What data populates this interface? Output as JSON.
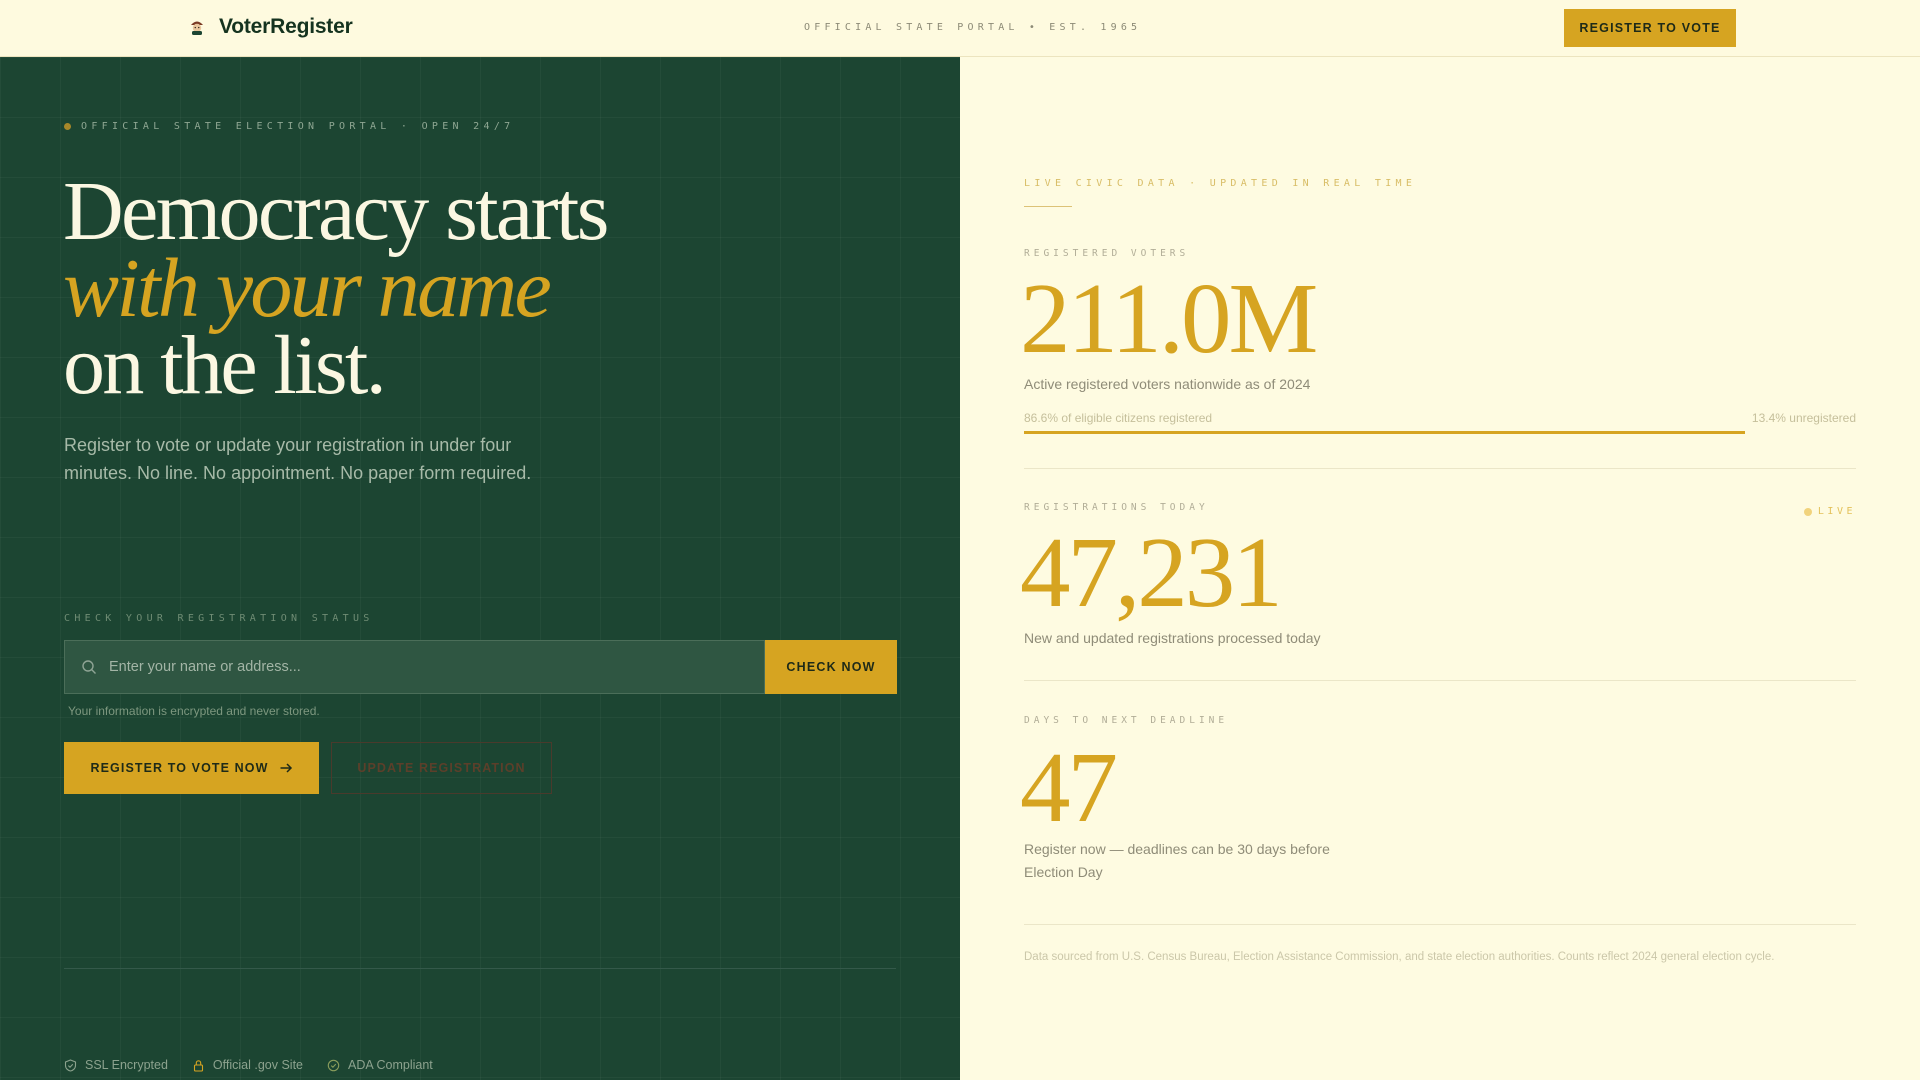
{
  "nav": {
    "brand": "VoterRegister",
    "tagline": "OFFICIAL STATE PORTAL • EST. 1965",
    "cta": "REGISTER TO VOTE"
  },
  "hero": {
    "eyebrow": "OFFICIAL STATE ELECTION PORTAL · OPEN 24/7",
    "headline_line1": "Democracy starts",
    "headline_line2": "with your name",
    "headline_line3": "on the list.",
    "subcopy": "Register to vote or update your registration in under four minutes. No line. No appointment. No paper form required.",
    "status_label": "CHECK YOUR REGISTRATION STATUS",
    "search_placeholder": "Enter your name or address...",
    "search_value": "",
    "check_button": "CHECK NOW",
    "privacy_note": "Your information is encrypted and never stored.",
    "primary_button": "REGISTER TO VOTE NOW",
    "secondary_button": "UPDATE REGISTRATION",
    "trust": [
      {
        "icon": "shield-icon",
        "label": "SSL Encrypted"
      },
      {
        "icon": "lock-icon",
        "label": "Official .gov Site"
      },
      {
        "icon": "check-circle-icon",
        "label": "ADA Compliant"
      }
    ]
  },
  "stats": {
    "eyebrow": "LIVE CIVIC DATA · UPDATED IN REAL TIME",
    "registered": {
      "label": "REGISTERED VOTERS",
      "value": "211.0M",
      "desc": "Active registered voters nationwide as of 2024",
      "bar_left": "86.6% of eligible citizens registered",
      "bar_right": "13.4% unregistered",
      "percent_registered": 86.6
    },
    "today": {
      "label": "REGISTRATIONS TODAY",
      "value": "47,231",
      "desc": "New and updated registrations processed today",
      "live": "LIVE"
    },
    "deadline": {
      "label": "DAYS TO NEXT DEADLINE",
      "value": "47",
      "desc": "Register now — deadlines can be 30 days before Election Day"
    },
    "source": "Data sourced from U.S. Census Bureau, Election Assistance Commission, and state election authorities. Counts reflect 2024 general election cycle."
  },
  "colors": {
    "hero_bg": "#1c4532",
    "accent": "#d6a421",
    "cream": "#fefbe1"
  }
}
